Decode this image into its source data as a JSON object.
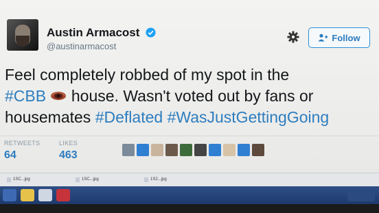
{
  "tweet": {
    "author_name": "Austin Armacost",
    "handle": "@austinarmacost",
    "follow_label": "Follow",
    "text": {
      "part1": "Feel completely robbed of my spot in the",
      "hashtag_cbb": "#CBB",
      "part2": " house. Wasn't voted out by fans or housemates ",
      "hashtag_deflated": "#Deflated",
      "hashtag_wasjust": "#WasJustGettingGoing"
    },
    "stats": {
      "retweets_label": "RETWEETS",
      "retweets_value": "64",
      "likes_label": "LIKES",
      "likes_value": "463"
    }
  },
  "downloads": {
    "items": [
      "1SC...jpg",
      "1SC...jpg",
      "1S2...jpg"
    ]
  },
  "colors": {
    "accent": "#2d7dbf",
    "verified": "#1da1f2",
    "taskbar": "#1e3a6d"
  },
  "icons": {
    "settings": "gear-icon",
    "follow": "add-user-icon",
    "verified": "verified-badge-icon"
  }
}
